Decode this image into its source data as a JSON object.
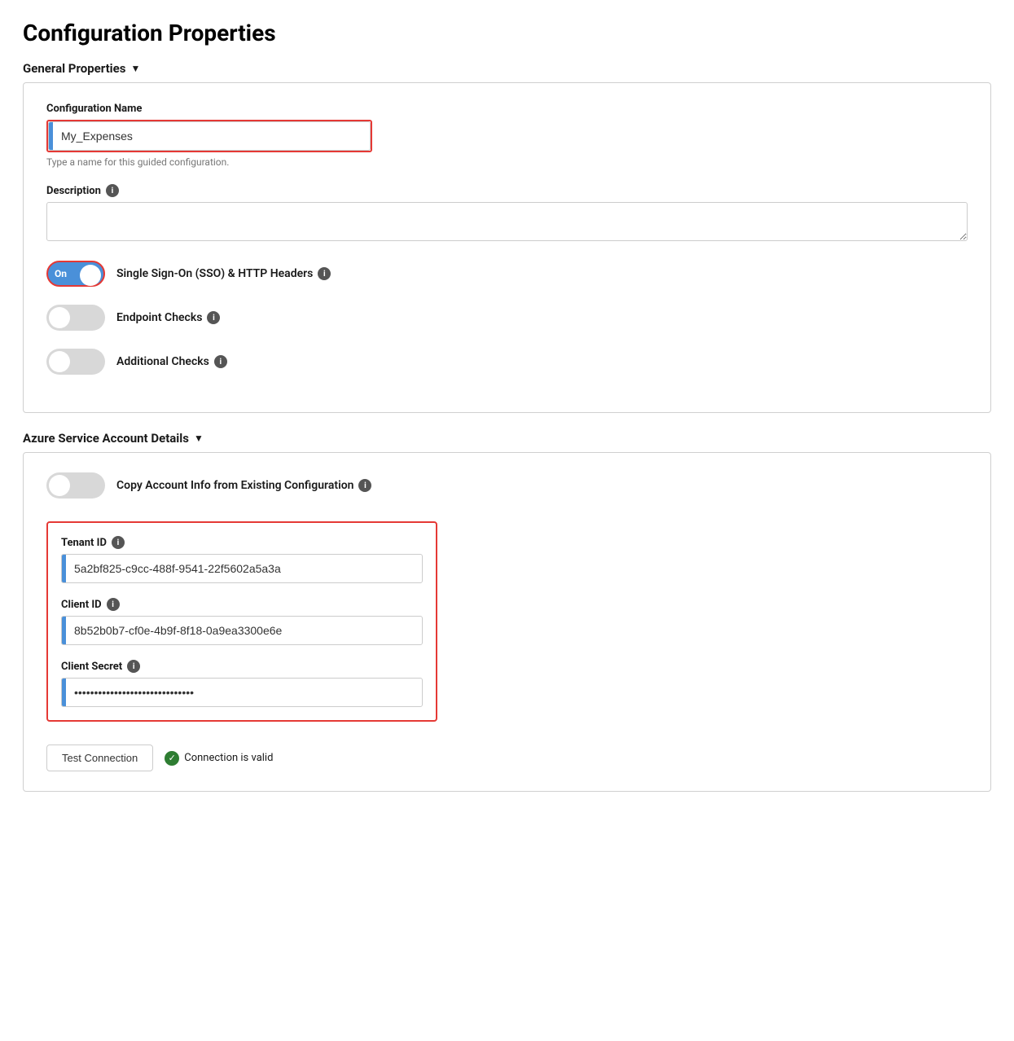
{
  "page": {
    "title": "Configuration Properties"
  },
  "general_properties": {
    "header": "General Properties",
    "chevron": "▼",
    "config_name": {
      "label": "Configuration Name",
      "value": "My_Expenses",
      "hint": "Type a name for this guided configuration."
    },
    "description": {
      "label": "Description",
      "info": "i"
    },
    "sso_toggle": {
      "label": "Single Sign-On (SSO) & HTTP Headers",
      "info": "i",
      "state": "on",
      "text": "On"
    },
    "endpoint_toggle": {
      "label": "Endpoint Checks",
      "info": "i",
      "state": "off"
    },
    "additional_toggle": {
      "label": "Additional Checks",
      "info": "i",
      "state": "off"
    }
  },
  "azure_details": {
    "header": "Azure Service Account Details",
    "chevron": "▼",
    "copy_toggle": {
      "label": "Copy Account Info from Existing Configuration",
      "info": "i",
      "state": "off"
    },
    "tenant_id": {
      "label": "Tenant ID",
      "info": "i",
      "value": "5a2bf825-c9cc-488f-9541-22f5602a5a3a"
    },
    "client_id": {
      "label": "Client ID",
      "info": "i",
      "value": "8b52b0b7-cf0e-4b9f-8f18-0a9ea3300e6e"
    },
    "client_secret": {
      "label": "Client Secret",
      "info": "i",
      "value": "••••••••••••••••••••••••••••••"
    },
    "test_button": "Test Connection",
    "connection_status": "Connection is valid"
  }
}
